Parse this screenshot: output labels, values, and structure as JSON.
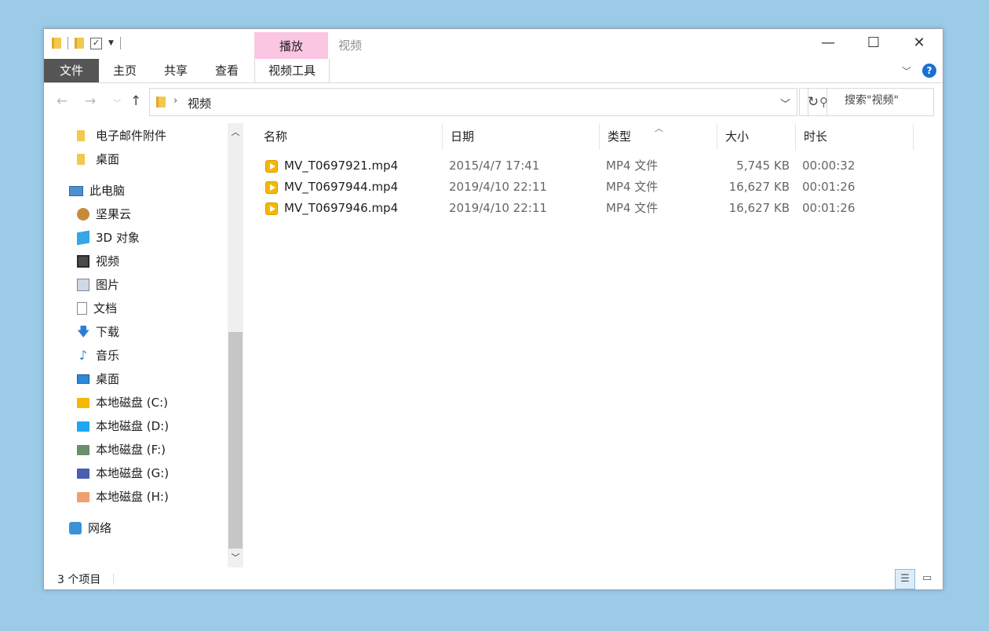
{
  "window": {
    "title": "视频",
    "context_tab": "播放",
    "controls": {
      "minimize": "—",
      "maximize": "☐",
      "close": "✕"
    }
  },
  "ribbon": {
    "tabs": [
      "文件",
      "主页",
      "共享",
      "查看",
      "视频工具"
    ],
    "help": "?"
  },
  "address": {
    "path": "视频",
    "separator": "›"
  },
  "search": {
    "placeholder": "搜索\"视频\""
  },
  "nav_pane": {
    "items": [
      {
        "label": "电子邮件附件",
        "icon": "folder-icon"
      },
      {
        "label": "桌面",
        "icon": "folder-icon"
      },
      {
        "label": "此电脑",
        "icon": "pc-icon"
      },
      {
        "label": "坚果云",
        "icon": "nutstore-icon"
      },
      {
        "label": "3D 对象",
        "icon": "cube-icon"
      },
      {
        "label": "视频",
        "icon": "video-icon"
      },
      {
        "label": "图片",
        "icon": "picture-icon"
      },
      {
        "label": "文档",
        "icon": "document-icon"
      },
      {
        "label": "下载",
        "icon": "download-icon"
      },
      {
        "label": "音乐",
        "icon": "music-icon"
      },
      {
        "label": "桌面",
        "icon": "desktop-icon"
      },
      {
        "label": "本地磁盘 (C:)",
        "icon": "drive-icon",
        "color": "#f5b800"
      },
      {
        "label": "本地磁盘 (D:)",
        "icon": "drive-icon",
        "color": "#1ea7f0"
      },
      {
        "label": "本地磁盘 (F:)",
        "icon": "drive-icon",
        "color": "#6b8e6b"
      },
      {
        "label": "本地磁盘 (G:)",
        "icon": "drive-icon",
        "color": "#4a5fb0"
      },
      {
        "label": "本地磁盘 (H:)",
        "icon": "drive-icon",
        "color": "#f0a070"
      },
      {
        "label": "网络",
        "icon": "network-icon"
      }
    ]
  },
  "file_list": {
    "columns": [
      "名称",
      "日期",
      "类型",
      "大小",
      "时长"
    ],
    "rows": [
      {
        "name": "MV_T0697921.mp4",
        "date": "2015/4/7 17:41",
        "type": "MP4 文件",
        "size": "5,745 KB",
        "duration": "00:00:32"
      },
      {
        "name": "MV_T0697944.mp4",
        "date": "2019/4/10 22:11",
        "type": "MP4 文件",
        "size": "16,627 KB",
        "duration": "00:01:26"
      },
      {
        "name": "MV_T0697946.mp4",
        "date": "2019/4/10 22:11",
        "type": "MP4 文件",
        "size": "16,627 KB",
        "duration": "00:01:26"
      }
    ]
  },
  "status": {
    "item_count": "3 个项目"
  }
}
